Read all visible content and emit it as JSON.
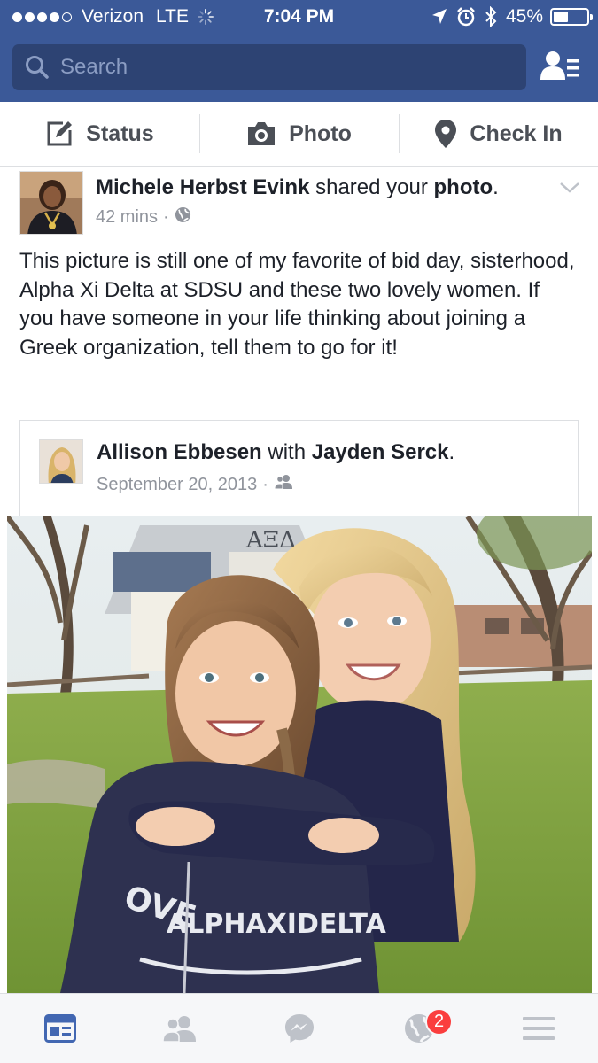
{
  "status_bar": {
    "carrier": "Verizon",
    "network": "LTE",
    "time": "7:04 PM",
    "battery": "45%",
    "battery_level": 0.45,
    "signal_bars_filled": 4,
    "signal_bars_total": 5,
    "icons": [
      "location-arrow-icon",
      "alarm-icon",
      "bluetooth-icon"
    ]
  },
  "search": {
    "placeholder": "Search"
  },
  "composer": {
    "status_label": "Status",
    "photo_label": "Photo",
    "checkin_label": "Check In"
  },
  "story": {
    "actor": "Michele Herbst Evink",
    "action": "shared your",
    "object": "photo",
    "time": "42 mins",
    "privacy_icon": "globe-icon",
    "text": "This picture is still one of my favorite of bid day, sisterhood, Alpha Xi Delta at SDSU and these two lovely women.  If you have someone in your life thinking about joining a Greek organization, tell them to go for it!"
  },
  "shared_post": {
    "author": "Allison Ebbesen",
    "with_word": "with",
    "tagged": "Jayden Serck",
    "date": "September 20, 2013",
    "privacy_icon": "friends-icon"
  },
  "photo_signage": {
    "house_letters": "ΑΞΔ",
    "sweatshirt_top": "OVE",
    "sweatshirt_main": "ALPHAXIDELTA"
  },
  "tabbar": {
    "tabs": [
      "news-feed-icon",
      "friends-icon",
      "messenger-icon",
      "notifications-globe-icon",
      "menu-icon"
    ],
    "notifications_badge": "2"
  },
  "colors": {
    "brand_blue": "#3b5998",
    "search_bg": "#2d4373",
    "badge_red": "#fa3e3e",
    "active_tab": "#4267b2"
  }
}
